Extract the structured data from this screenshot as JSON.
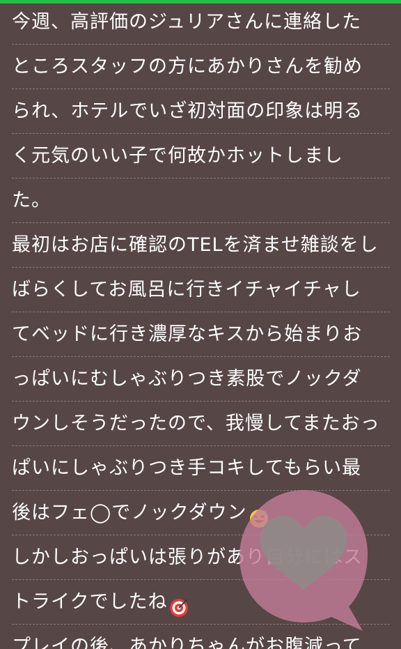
{
  "review": {
    "lines": [
      "今週、高評価のジュリアさんに連絡した",
      "ところスタッフの方にあかりさんを勧め",
      "られ、ホテルでいざ初対面の印象は明る",
      "く元気のいい子で何故かホットしまし",
      "た。",
      "最初はお店に確認のTELを済ませ雑談をし",
      "ばらくしてお風呂に行きイチャイチャし",
      "てベッドに行き濃厚なキスから始まりお",
      "っぱいにむしゃぶりつき素股でノックダ",
      "ウンしそうだったので、我慢してまたおっ",
      "ぱいにしゃぶりつき手コキしてもらい最",
      "後はフェ◯でノックダウン",
      "しかしおっぱいは張りがあり自分にはス",
      "トライクでしたね",
      "プレイの後、あかりちゃんがお腹減って"
    ]
  },
  "icons": {
    "line12_emoji": "sweat-smile-emoji-icon",
    "line14_emoji": "target-emoji-icon",
    "floating": "heart-speech-bubble-icon"
  },
  "colors": {
    "background": "#574646",
    "accent_bar": "#22c24a",
    "text": "#ffffff",
    "bubble": "#c27d97"
  }
}
